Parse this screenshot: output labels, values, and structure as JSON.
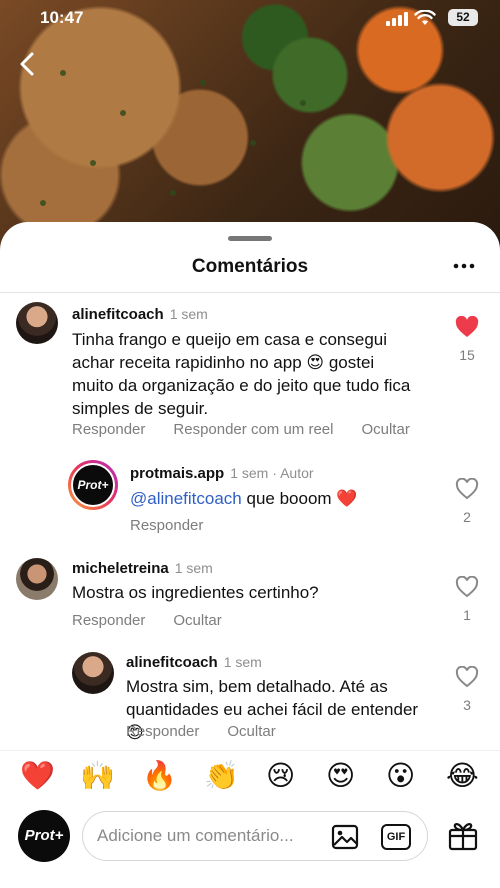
{
  "status": {
    "time": "10:47",
    "battery": "52"
  },
  "sheet": {
    "title": "Comentários"
  },
  "comments": [
    {
      "username": "alinefitcoach",
      "time": "1 sem",
      "text": "Tinha frango e queijo em casa e consegui achar receita rapidinho no app 😍 gostei muito da organização e do jeito que tudo fica simples de seguir.",
      "actions": [
        "Responder",
        "Responder com um reel",
        "Ocultar"
      ],
      "likes": "15",
      "liked": true
    },
    {
      "username": "protmais.app",
      "time": "1 sem",
      "badge": "· Autor",
      "mention": "@alinefitcoach",
      "text": " que booom ❤️",
      "actions": [
        "Responder"
      ],
      "likes": "2",
      "avatar_label": "Prot+"
    },
    {
      "username": "micheletreina",
      "time": "1 sem",
      "text": "Mostra os ingredientes certinho?",
      "actions": [
        "Responder",
        "Ocultar"
      ],
      "likes": "1"
    },
    {
      "username": "alinefitcoach",
      "time": "1 sem",
      "text": "Mostra sim, bem detalhado. Até as quantidades eu achei fácil de entender 😊",
      "actions": [
        "Responder",
        "Ocultar"
      ],
      "likes": "3"
    }
  ],
  "emoji_bar": [
    "❤️",
    "🙌",
    "🔥",
    "👏",
    "😢",
    "😍",
    "😮",
    "😂"
  ],
  "composer": {
    "avatar_label": "Prot+",
    "placeholder": "Adicione um comentário...",
    "gif_label": "GIF"
  },
  "colors": {
    "like_red": "#ed3b4c",
    "mention_blue": "#2f5fc4",
    "muted": "#7d7d7d"
  }
}
